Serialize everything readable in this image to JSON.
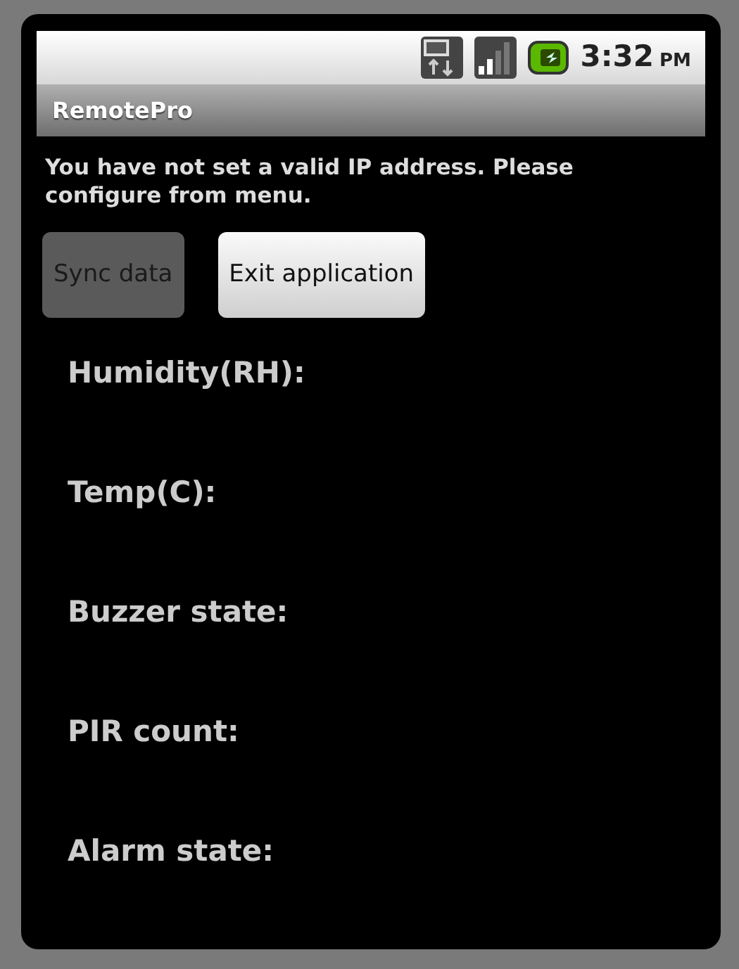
{
  "status_bar": {
    "time": "3:32",
    "meridiem": "PM"
  },
  "window": {
    "title": "RemotePro"
  },
  "message": "You have not set a valid IP address. Please configure from menu.",
  "buttons": [
    {
      "label": "Sync data",
      "disabled": true
    },
    {
      "label": "Exit application",
      "disabled": false
    }
  ],
  "readings": [
    {
      "label": "Humidity(RH):"
    },
    {
      "label": "Temp(C):"
    },
    {
      "label": "Buzzer state:"
    },
    {
      "label": "PIR count:"
    },
    {
      "label": "Alarm state:"
    }
  ]
}
